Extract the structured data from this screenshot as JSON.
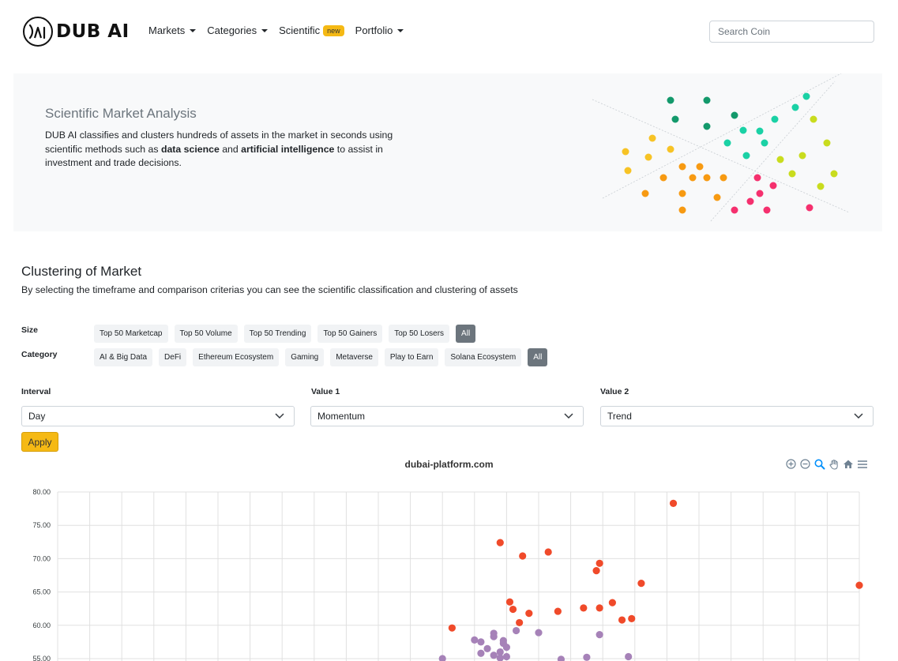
{
  "brand": {
    "name": "DUB AI"
  },
  "nav": {
    "markets": "Markets",
    "categories": "Categories",
    "scientific": "Scientific",
    "scientific_badge": "new",
    "portfolio": "Portfolio"
  },
  "search": {
    "placeholder": "Search Coin"
  },
  "hero": {
    "title": "Scientific Market Analysis",
    "text_part1": "DUB AI classifies and clusters hundreds of assets in the market in seconds using scientific methods such as ",
    "text_bold1": "data science",
    "text_part2": " and ",
    "text_bold2": "artificial intelligence",
    "text_part3": " to assist in investment and trade decisions."
  },
  "clustering": {
    "title": "Clustering of Market",
    "subtitle": "By selecting the timeframe and comparison criterias you can see the scientific classification and clustering of assets"
  },
  "filters": {
    "size_label": "Size",
    "size_options": [
      "Top 50 Marketcap",
      "Top 50 Volume",
      "Top 50 Trending",
      "Top 50 Gainers",
      "Top 50 Losers",
      "All"
    ],
    "size_selected": "All",
    "category_label": "Category",
    "category_options": [
      "AI & Big Data",
      "DeFi",
      "Ethereum Ecosystem",
      "Gaming",
      "Metaverse",
      "Play to Earn",
      "Solana Ecosystem",
      "All"
    ],
    "category_selected": "All"
  },
  "selects": {
    "interval_label": "Interval",
    "interval_value": "Day",
    "value1_label": "Value 1",
    "value1_value": "Momentum",
    "value2_label": "Value 2",
    "value2_value": "Trend"
  },
  "apply_label": "Apply",
  "colors": {
    "accent": "#f5b914",
    "cluster_red": "#f04a2a",
    "cluster_purple": "#a682b8",
    "hero_green": "#13996b",
    "hero_teal": "#1ad1a5",
    "hero_lime": "#c9dc1e",
    "hero_yellow": "#f7c325",
    "hero_orange": "#f79a12",
    "hero_pink": "#f5306e"
  },
  "toolbar_icons": [
    "zoom-in-icon",
    "zoom-out-icon",
    "zoom-select-icon",
    "pan-hand-icon",
    "home-reset-icon",
    "menu-icon"
  ],
  "chart_data": {
    "type": "scatter",
    "title": "dubai-platform.com",
    "xlabel": "",
    "ylabel": "",
    "ylim": [
      52.5,
      80
    ],
    "y_ticks": [
      "80.00",
      "75.00",
      "70.00",
      "65.00",
      "60.00",
      "55.00"
    ],
    "xlim": [
      0,
      25
    ],
    "grid": true,
    "series": [
      {
        "color": "#f04a2a",
        "points": [
          [
            19.2,
            78.3
          ],
          [
            13.8,
            72.4
          ],
          [
            15.3,
            71.0
          ],
          [
            14.5,
            70.4
          ],
          [
            16.9,
            69.3
          ],
          [
            16.8,
            68.2
          ],
          [
            18.2,
            66.3
          ],
          [
            25.0,
            66.0
          ],
          [
            14.1,
            63.5
          ],
          [
            17.3,
            63.4
          ],
          [
            14.2,
            62.4
          ],
          [
            16.4,
            62.6
          ],
          [
            16.9,
            62.6
          ],
          [
            14.7,
            61.8
          ],
          [
            15.6,
            62.1
          ],
          [
            17.6,
            60.8
          ],
          [
            17.9,
            61.0
          ],
          [
            12.3,
            59.6
          ],
          [
            14.4,
            60.4
          ]
        ]
      },
      {
        "color": "#a682b8",
        "points": [
          [
            13.6,
            58.8
          ],
          [
            13.6,
            58.3
          ],
          [
            13.0,
            57.8
          ],
          [
            13.2,
            57.5
          ],
          [
            13.9,
            57.7
          ],
          [
            13.9,
            57.3
          ],
          [
            13.4,
            56.5
          ],
          [
            14.0,
            56.7
          ],
          [
            13.8,
            56.0
          ],
          [
            13.2,
            55.8
          ],
          [
            14.3,
            59.2
          ],
          [
            15.0,
            58.9
          ],
          [
            16.9,
            58.6
          ],
          [
            13.6,
            55.5
          ],
          [
            14.0,
            55.3
          ],
          [
            12.0,
            55.0
          ],
          [
            16.5,
            55.2
          ],
          [
            17.8,
            55.3
          ],
          [
            15.7,
            54.9
          ],
          [
            13.8,
            55.1
          ]
        ]
      }
    ]
  }
}
